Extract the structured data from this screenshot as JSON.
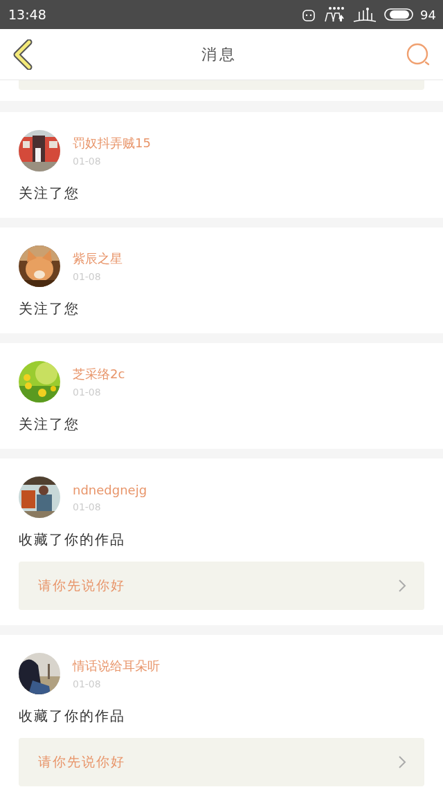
{
  "status_bar": {
    "time": "13:48",
    "battery": "94"
  },
  "header": {
    "title": "消息"
  },
  "messages": [
    {
      "user": "罚奴抖弄贼15",
      "date": "01-08",
      "action": "关注了您"
    },
    {
      "user": "紫辰之星",
      "date": "01-08",
      "action": "关注了您"
    },
    {
      "user": "芝采络2c",
      "date": "01-08",
      "action": "关注了您"
    },
    {
      "user": "ndnedgnejg",
      "date": "01-08",
      "action": "收藏了你的作品",
      "work": "请你先说你好"
    },
    {
      "user": "情话说给耳朵听",
      "date": "01-08",
      "action": "收藏了你的作品",
      "work": "请你先说你好"
    }
  ]
}
